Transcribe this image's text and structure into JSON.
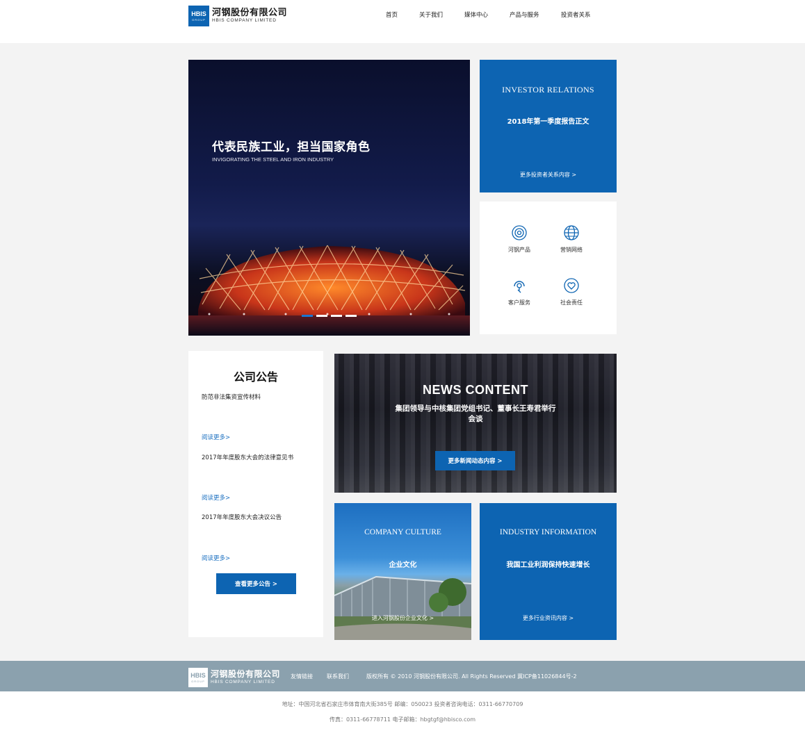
{
  "brand": {
    "logo_mark": "HBIS",
    "logo_group": "GROUP",
    "name_cn": "河钢股份有限公司",
    "name_en": "HBIS COMPANY LIMITED",
    "color": "#0d64b2"
  },
  "nav": {
    "items": [
      "首页",
      "关于我们",
      "媒体中心",
      "产品与服务",
      "投资者关系"
    ]
  },
  "hero": {
    "title": "代表民族工业，担当国家角色",
    "subtitle": "INVIGORATING THE STEEL AND IRON INDUSTRY",
    "slides": 4,
    "active_slide": 1
  },
  "investor": {
    "heading": "INVESTOR RELATIONS",
    "title": "2018年第一季度报告正文",
    "more": "更多投资者关系内容 >"
  },
  "quick_links": [
    {
      "label": "河钢产品",
      "icon": "coil-icon"
    },
    {
      "label": "营销网络",
      "icon": "globe-icon"
    },
    {
      "label": "客户服务",
      "icon": "headset-icon"
    },
    {
      "label": "社会责任",
      "icon": "heart-icon"
    }
  ],
  "notice": {
    "heading": "公司公告",
    "items": [
      {
        "title": "防范非法集资宣传材料",
        "more": "阅读更多>"
      },
      {
        "title": "2017年年度股东大会的法律意见书",
        "more": "阅读更多>"
      },
      {
        "title": "2017年年度股东大会决议公告",
        "more": "阅读更多>"
      }
    ],
    "button": "查看更多公告 >"
  },
  "news": {
    "heading": "NEWS CONTENT",
    "title": "集团领导与中核集团党组书记、董事长王寿君举行会谈",
    "button": "更多新闻动态内容 >"
  },
  "culture": {
    "heading": "COMPANY CULTURE",
    "title": "企业文化",
    "more": "进入河钢股份企业文化 >"
  },
  "industry": {
    "heading": "INDUSTRY INFORMATION",
    "title": "我国工业利润保持快速增长",
    "more": "更多行业资讯内容 >"
  },
  "footer": {
    "links": [
      "友情链接",
      "联系我们"
    ],
    "copyright": "版权所有 © 2010 河钢股份有限公司. All Rights Reserved    冀ICP备11026844号-2",
    "address": "地址：中国河北省石家庄市体育南大街385号   邮编：050023   投资者咨询电话：0311-66770709",
    "contact": "传真：0311-66778711   电子邮箱：hbgtgf@hbisco.com"
  }
}
